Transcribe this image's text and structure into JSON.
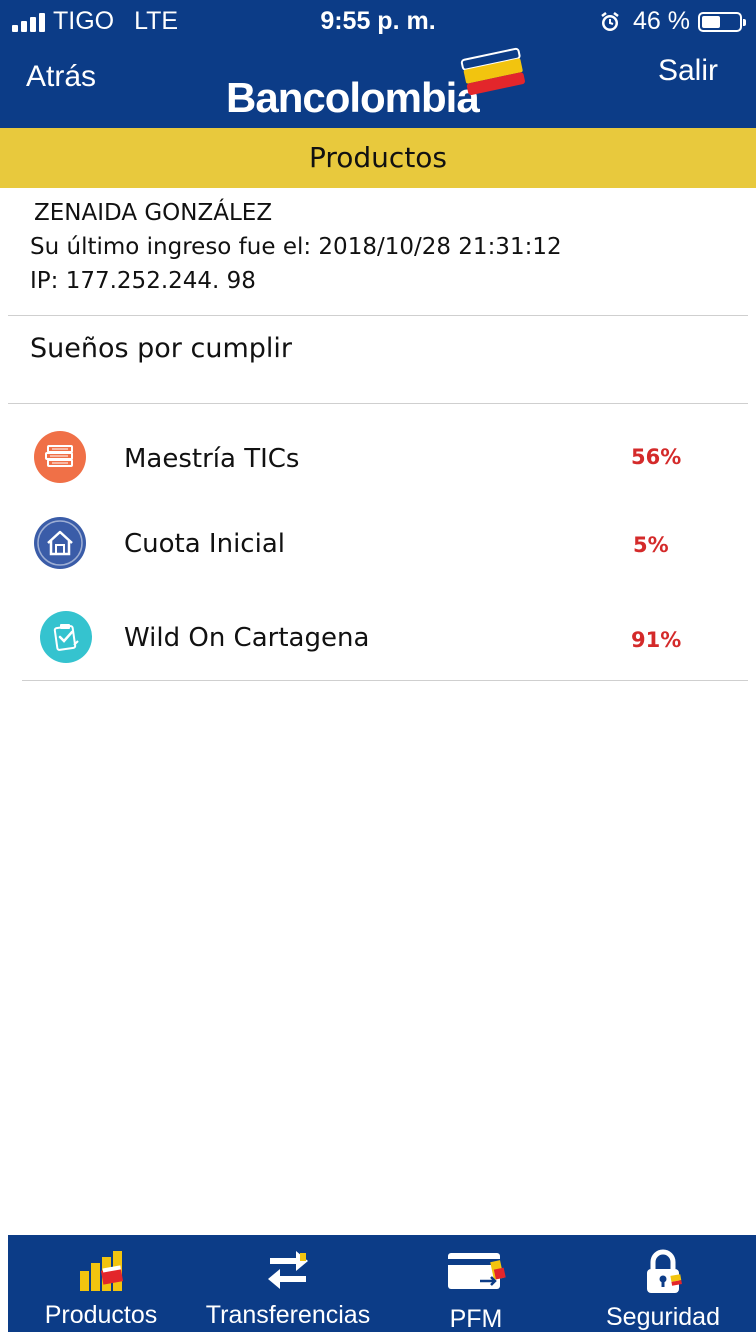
{
  "status_bar": {
    "carrier": "TIGO",
    "network": "LTE",
    "time": "9:55 p. m.",
    "battery_percent": "46 %",
    "battery_level": 0.46
  },
  "nav": {
    "back_label": "Atrás",
    "brand": "Bancolombia",
    "exit_label": "Salir"
  },
  "section_title": "Productos",
  "user": {
    "name": "ZENAIDA GONZÁLEZ",
    "last_login": "Su último ingreso fue el: 2018/10/28 21:31:12",
    "ip": "IP: 177.252.244. 98"
  },
  "dreams": {
    "title": "Sueños por cumplir",
    "items": [
      {
        "label": "Maestría TICs",
        "percent": "56%",
        "icon": "books-icon",
        "color": "#f07047"
      },
      {
        "label": "Cuota Inicial",
        "percent": "5%",
        "icon": "house-icon",
        "color": "#3a5ca8"
      },
      {
        "label": "Wild On Cartagena",
        "percent": "91%",
        "icon": "checklist-icon",
        "color": "#35c3cf"
      }
    ]
  },
  "tabs": [
    {
      "label": "Productos",
      "icon": "products-icon"
    },
    {
      "label": "Transferencias",
      "icon": "transfer-arrows-icon"
    },
    {
      "label": "PFM",
      "icon": "card-icon"
    },
    {
      "label": "Seguridad",
      "icon": "lock-icon"
    }
  ],
  "colors": {
    "brand_blue": "#0c3c87",
    "brand_yellow": "#e8c93d",
    "percent_red": "#d42a2a"
  }
}
